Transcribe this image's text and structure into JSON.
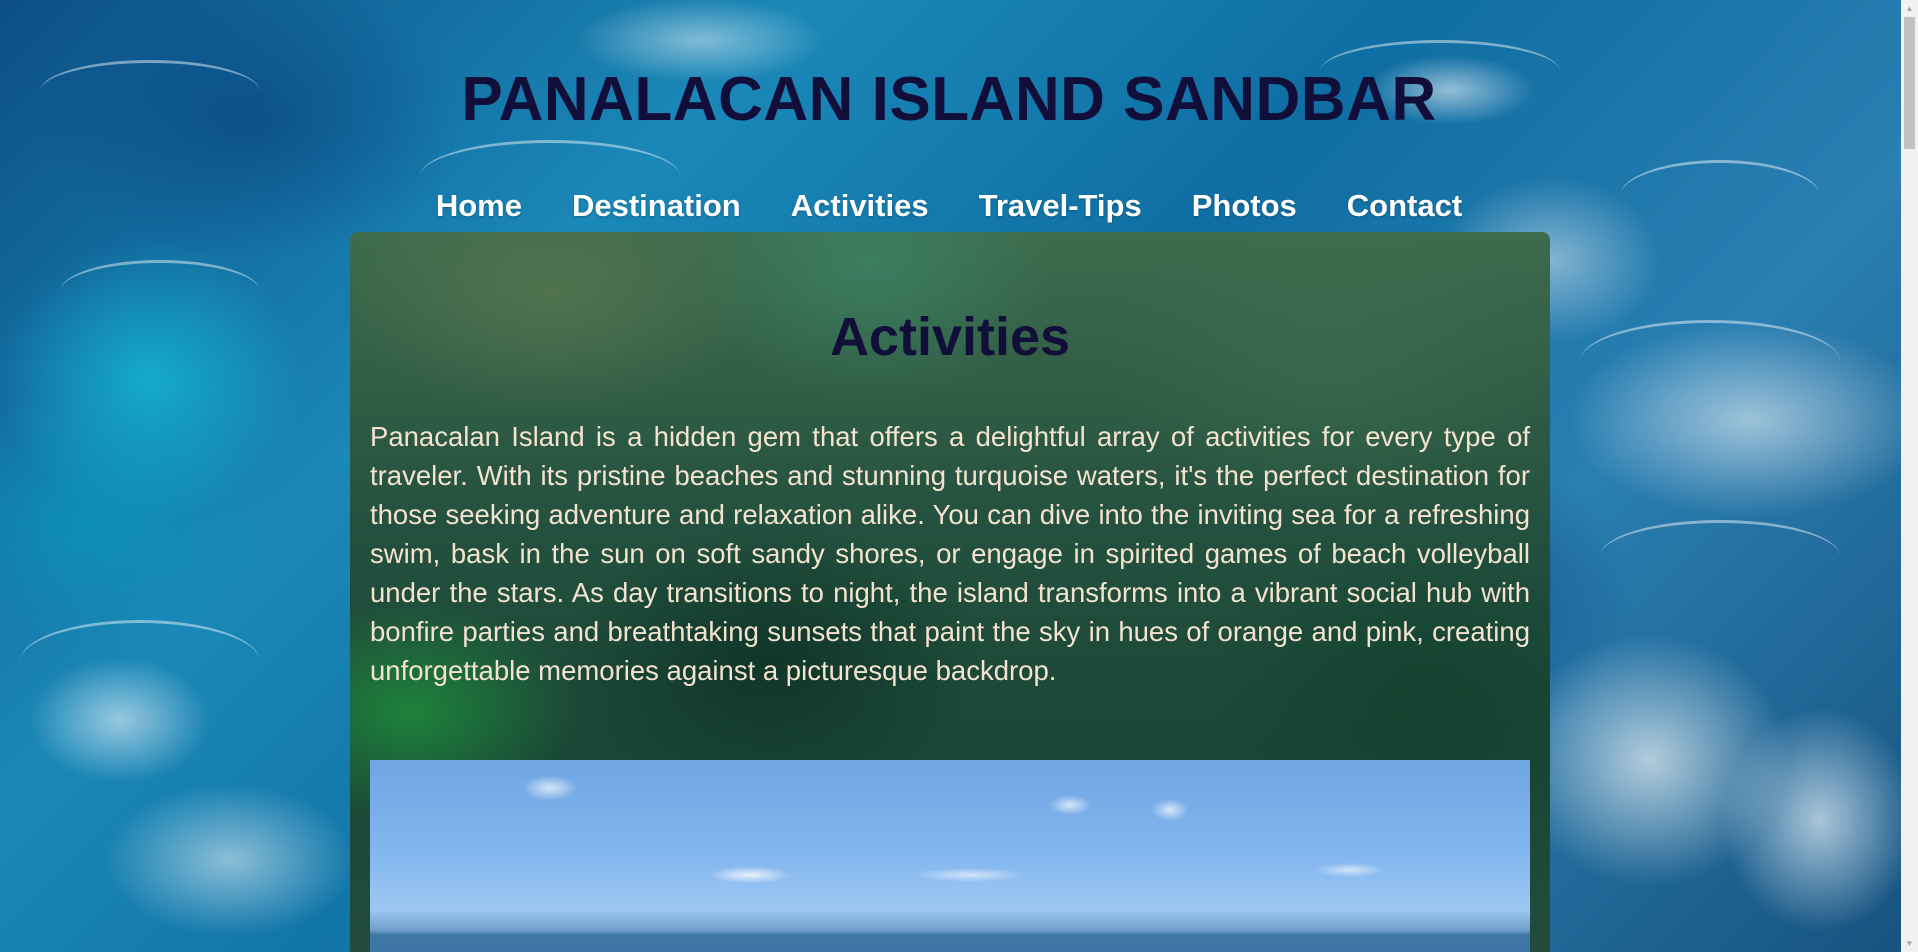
{
  "header": {
    "title": "PANALACAN ISLAND SANDBAR"
  },
  "nav": {
    "items": [
      {
        "label": "Home"
      },
      {
        "label": "Destination"
      },
      {
        "label": "Activities"
      },
      {
        "label": "Travel-Tips"
      },
      {
        "label": "Photos"
      },
      {
        "label": "Contact"
      }
    ]
  },
  "main": {
    "heading": "Activities",
    "paragraph": "Panacalan Island is a hidden gem that offers a delightful array of activities for every type of traveler. With its pristine beaches and stunning turquoise waters, it's the perfect destination for those seeking adventure and relaxation alike. You can dive into the inviting sea for a refreshing swim, bask in the sun on soft sandy shores, or engage in spirited games of beach volleyball under the stars. As day transitions to night, the island transforms into a vibrant social hub with bonfire parties and breathtaking sunsets that paint the sky in hues of orange and pink, creating unforgettable memories against a picturesque backdrop."
  },
  "colors": {
    "title": "#120e3a",
    "nav_text": "#ffffff",
    "paragraph_text": "#f3e3cf"
  },
  "icons": {
    "scroll_up": "chevron-up-icon",
    "scroll_down": "chevron-down-icon"
  }
}
